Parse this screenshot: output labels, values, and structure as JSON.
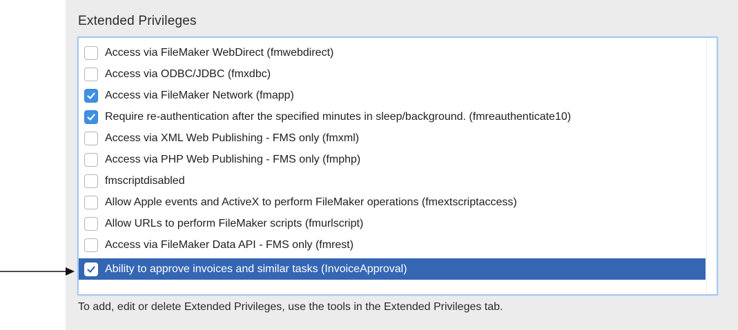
{
  "section": {
    "title": "Extended Privileges"
  },
  "privileges": [
    {
      "label": "Access via FileMaker WebDirect (fmwebdirect)",
      "checked": false,
      "selected": false
    },
    {
      "label": "Access via ODBC/JDBC (fmxdbc)",
      "checked": false,
      "selected": false
    },
    {
      "label": "Access via FileMaker Network (fmapp)",
      "checked": true,
      "selected": false
    },
    {
      "label": "Require re-authentication after the specified minutes in sleep/background. (fmreauthenticate10)",
      "checked": true,
      "selected": false
    },
    {
      "label": "Access via XML Web Publishing - FMS only (fmxml)",
      "checked": false,
      "selected": false
    },
    {
      "label": "Access via PHP Web Publishing - FMS only (fmphp)",
      "checked": false,
      "selected": false
    },
    {
      "label": "fmscriptdisabled",
      "checked": false,
      "selected": false
    },
    {
      "label": "Allow Apple events and ActiveX to perform FileMaker operations (fmextscriptaccess)",
      "checked": false,
      "selected": false
    },
    {
      "label": "Allow URLs to perform FileMaker scripts (fmurlscript)",
      "checked": false,
      "selected": false
    },
    {
      "label": "Access via FileMaker Data API - FMS only (fmrest)",
      "checked": false,
      "selected": false
    },
    {
      "label": "Ability to approve invoices and similar tasks (InvoiceApproval)",
      "checked": true,
      "selected": true
    }
  ],
  "footer": {
    "note": "To add, edit or delete Extended Privileges, use the tools in the Extended Privileges tab."
  },
  "icons": {
    "check": "checkmark-icon",
    "pointer": "arrow-right-icon"
  },
  "colors": {
    "selection": "#3466b4",
    "checkbox_on": "#3f8fe3",
    "focus_ring": "#a9c8ec",
    "panel": "#ececec"
  }
}
